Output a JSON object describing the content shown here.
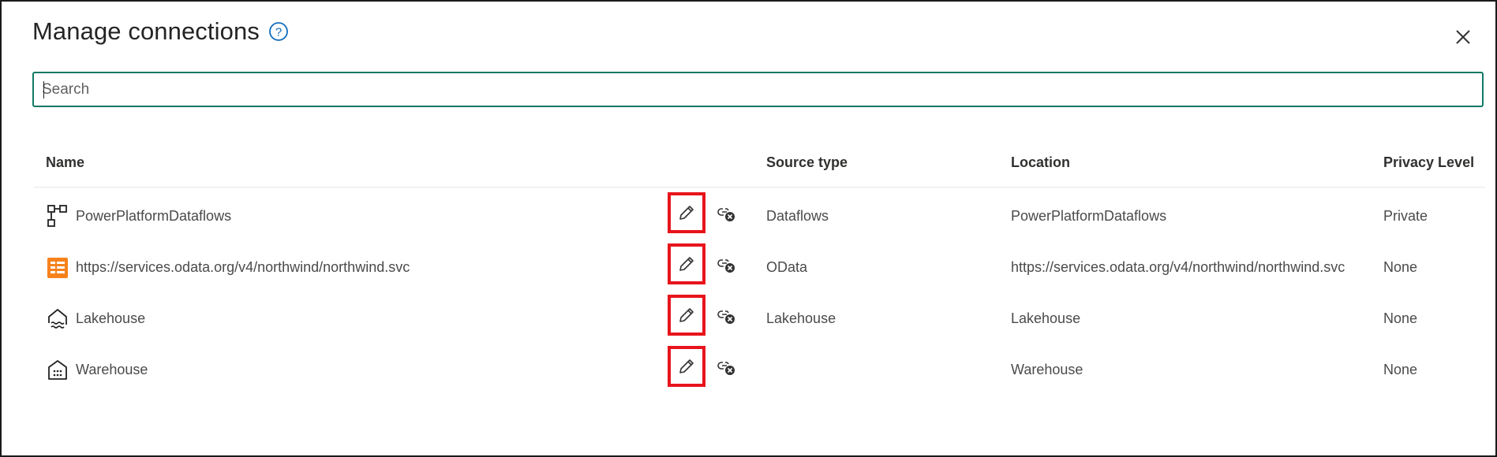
{
  "dialog": {
    "title": "Manage connections",
    "help_icon": "question-circle-icon",
    "close_icon": "close-x-icon"
  },
  "search": {
    "placeholder": "Search",
    "value": ""
  },
  "table": {
    "columns": [
      "Name",
      "Source type",
      "Location",
      "Privacy Level"
    ],
    "rows": [
      {
        "icon": "dataflow-icon",
        "name": "PowerPlatformDataflows",
        "source_type": "Dataflows",
        "location": "PowerPlatformDataflows",
        "privacy": "Private"
      },
      {
        "icon": "odata-icon",
        "name": "https://services.odata.org/v4/northwind/northwind.svc",
        "source_type": "OData",
        "location": "https://services.odata.org/v4/northwind/northwind.svc",
        "privacy": "None"
      },
      {
        "icon": "lakehouse-icon",
        "name": "Lakehouse",
        "source_type": "Lakehouse",
        "location": "Lakehouse",
        "privacy": "None"
      },
      {
        "icon": "warehouse-icon",
        "name": "Warehouse",
        "source_type": "",
        "location": "Warehouse",
        "privacy": "None"
      }
    ],
    "row_actions": {
      "edit_icon": "pencil-icon",
      "remove_icon": "unlink-icon"
    }
  },
  "colors": {
    "accent": "#117865",
    "highlight": "#e8141c",
    "help": "#0f6cbd",
    "odata": "#f7821b"
  }
}
